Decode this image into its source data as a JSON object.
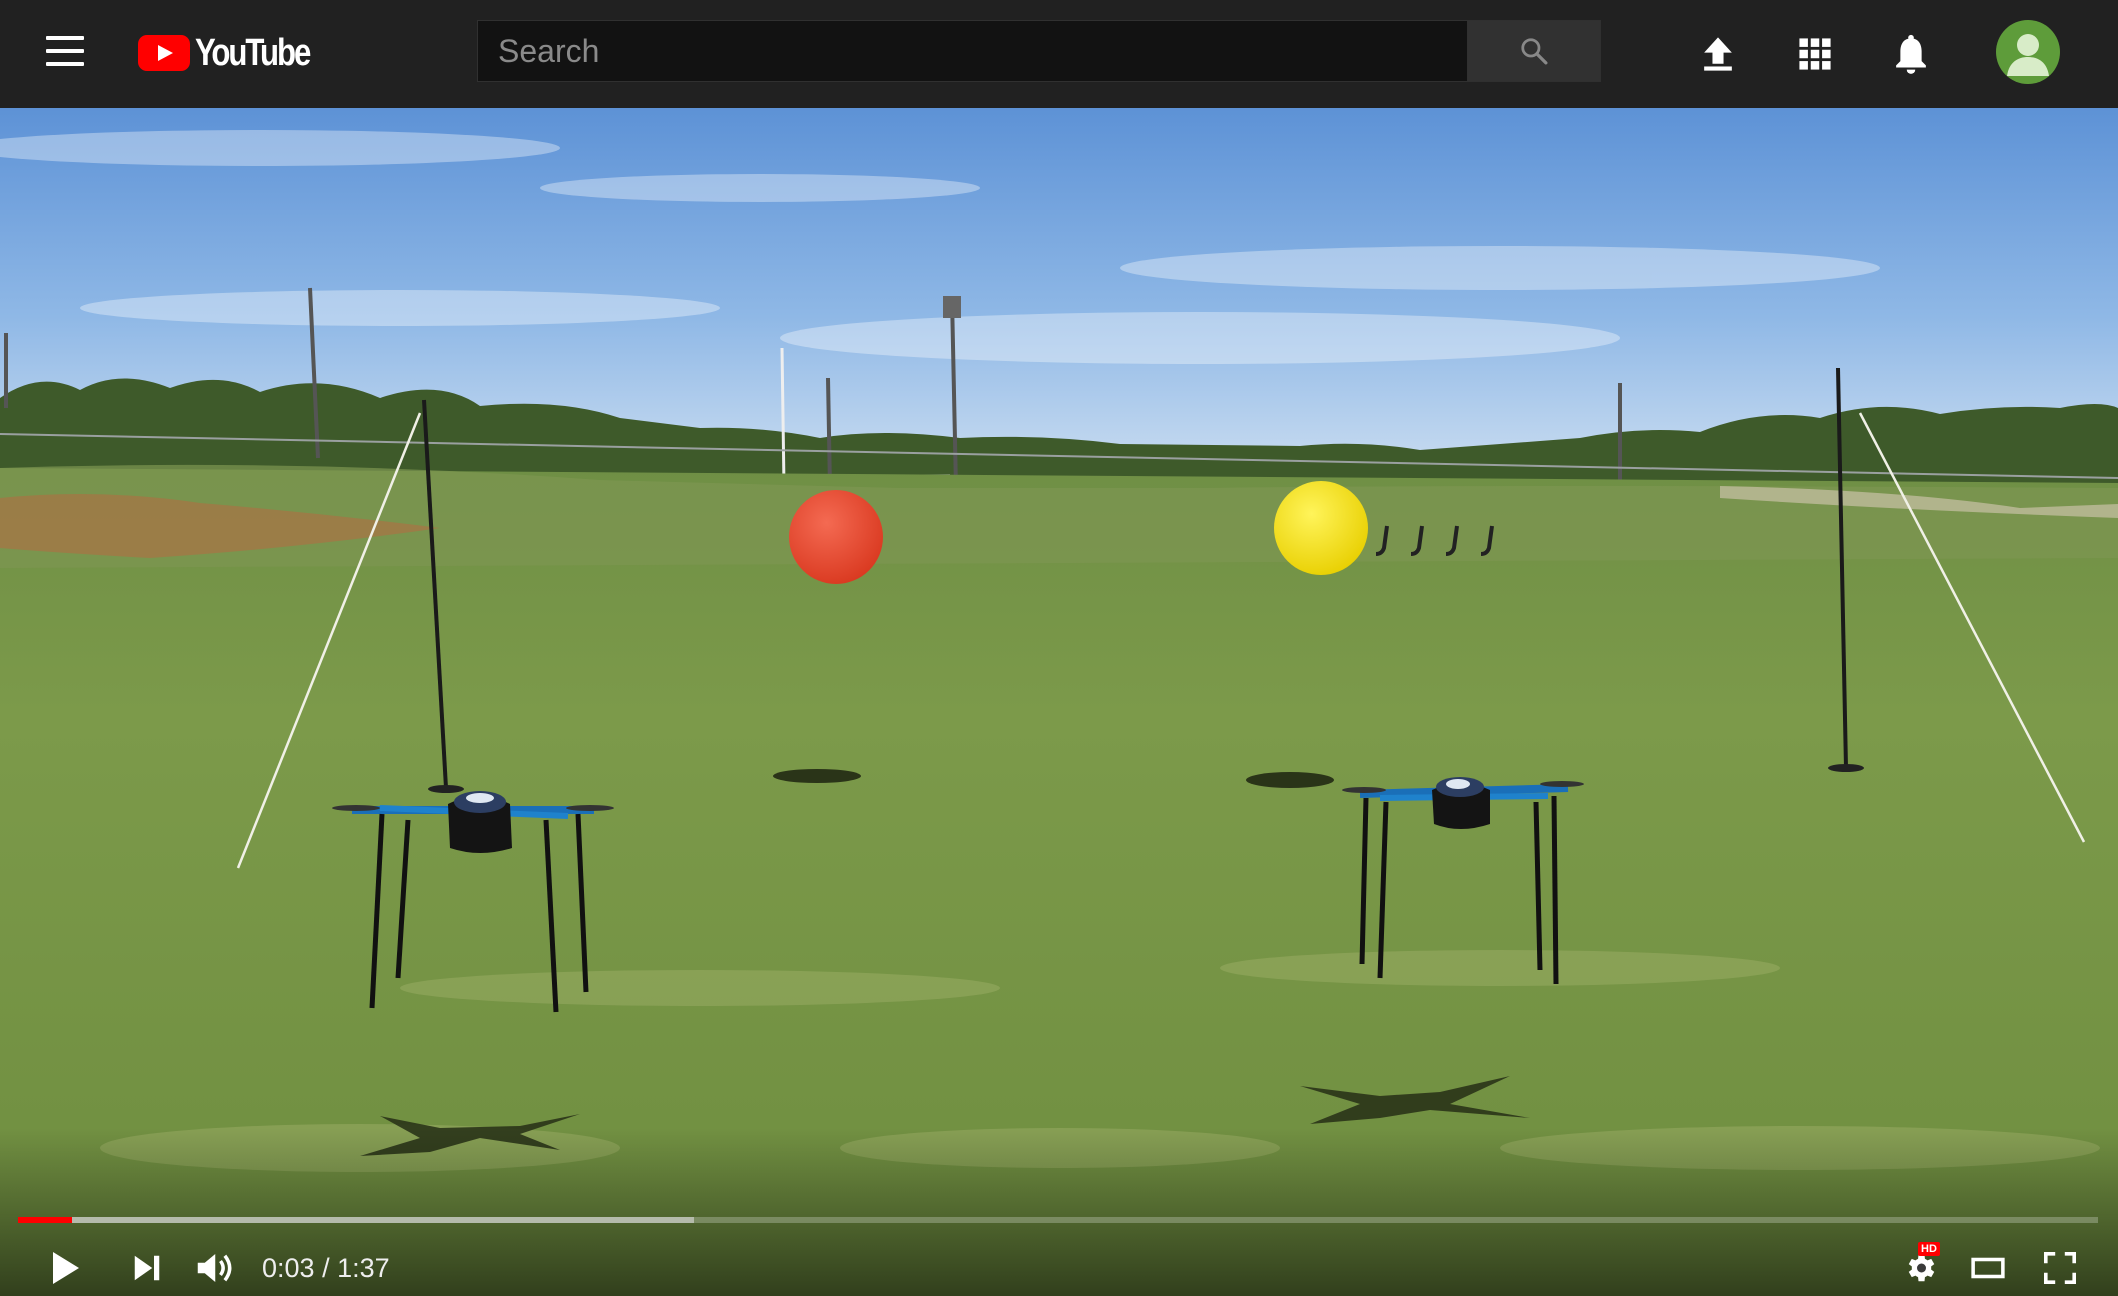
{
  "header": {
    "logo_text": "YouTube",
    "search_placeholder": "Search"
  },
  "player": {
    "current_time": "0:03",
    "time_separator": " / ",
    "duration": "1:37",
    "played_fraction": 0.026,
    "loaded_fraction": 0.325,
    "hd_badge": "HD"
  },
  "icons": {
    "menu": "menu-icon",
    "search": "search-icon",
    "upload": "upload-icon",
    "apps": "apps-icon",
    "notifications": "bell-icon",
    "account": "avatar",
    "play": "play-icon",
    "next": "next-icon",
    "volume": "volume-icon",
    "settings": "gear-icon",
    "theater": "theater-mode-icon",
    "fullscreen": "fullscreen-icon"
  },
  "colors": {
    "topbar": "#212121",
    "brand_red": "#ff0000",
    "progress_played": "#ff0000",
    "avatar_bg": "#5e9c3a"
  }
}
